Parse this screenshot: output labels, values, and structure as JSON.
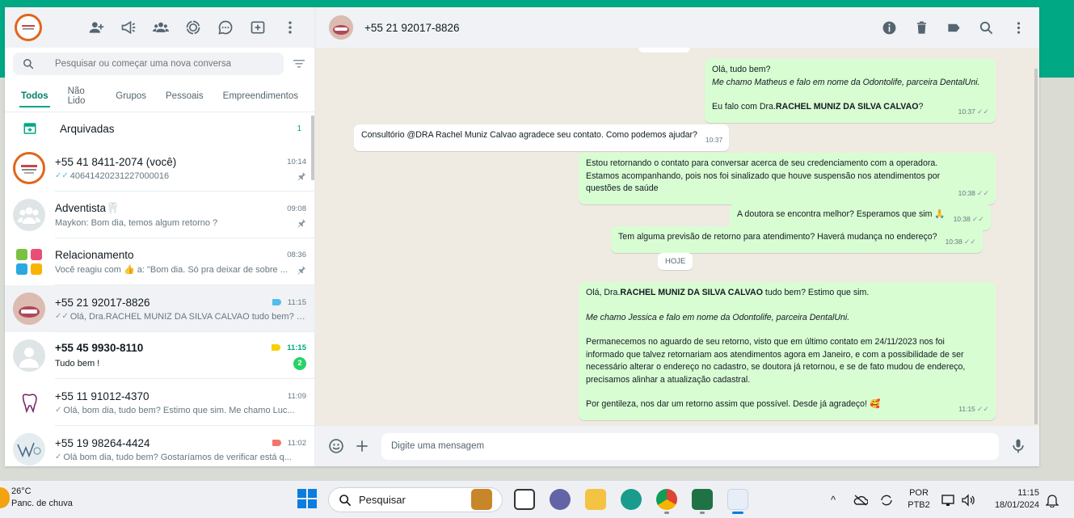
{
  "colors": {
    "brand": "#00a884",
    "outgoing": "#d9fdd3",
    "incoming": "#ffffff",
    "chatbg": "#efeae2"
  },
  "sidebar": {
    "search_placeholder": "Pesquisar ou começar uma nova conversa",
    "header_icons": [
      "new-contact-icon",
      "channels-icon",
      "communities-icon",
      "status-icon",
      "chat-bubble-icon",
      "new-chat-icon",
      "menu-icon"
    ],
    "tabs": [
      {
        "label": "Todos"
      },
      {
        "label": "Não Lido"
      },
      {
        "label": "Grupos"
      },
      {
        "label": "Pessoais"
      },
      {
        "label": "Empreendimentos"
      }
    ],
    "archived": {
      "label": "Arquivadas",
      "count": "1"
    },
    "chats": [
      {
        "name": "+55 41 8411-2074 (você)",
        "time": "10:14",
        "preview": "40641420231227000016"
      },
      {
        "name": "Adventista🦷",
        "time": "09:08",
        "preview": "Maykon: Bom dia, temos algum retorno ?"
      },
      {
        "name": "Relacionamento",
        "time": "08:36",
        "preview": "Você reagiu com 👍 a: \"Bom dia. Só pra deixar de sobre ..."
      },
      {
        "name": "+55 21 92017-8826",
        "time": "11:15",
        "preview": "Olá, Dra.RACHEL MUNIZ DA SILVA CALVAO tudo bem? E..."
      },
      {
        "name": "+55 45 9930-8110",
        "time": "11:15",
        "preview": "Tudo bem !",
        "unread": "2"
      },
      {
        "name": "+55 11 91012-4370",
        "time": "11:09",
        "preview": "Olá, bom dia, tudo bem? Estimo que sim. Me chamo Luc..."
      },
      {
        "name": "+55 19 98264-4424",
        "time": "11:02",
        "preview": "Olá bom dia, tudo bem? Gostaríamos de verificar está q..."
      }
    ]
  },
  "conversation": {
    "title": "+55 21 92017-8826",
    "composer_placeholder": "Digite uma mensagem",
    "date_chip": "HOJE",
    "messages": [
      {
        "l1": "Olá, tudo bem?",
        "l2": "Me chamo Matheus e falo em nome da Odontolife, parceira DentalUni.",
        "l3a": "Eu falo com Dra.",
        "l3b": "RACHEL MUNIZ DA SILVA CALVAO",
        "l3c": "?",
        "time": "10:37"
      },
      {
        "text": "Consultório @DRA Rachel Muniz Calvao agradece seu contato. Como podemos ajudar?",
        "time": "10:37"
      },
      {
        "l1": "Estou retornando o contato para conversar acerca de seu credenciamento com a operadora.",
        "l2": "Estamos acompanhando, pois nos foi sinalizado que houve suspensão nos atendimentos por",
        "l3": "questões de saúde",
        "time": "10:38"
      },
      {
        "text": "A doutora se encontra melhor? Esperamos que sim 🙏",
        "time": "10:38"
      },
      {
        "text": "Tem alguma previsão de retorno para atendimento? Haverá mudança no endereço?",
        "time": "10:38"
      },
      {
        "l1a": "Olá, Dra.",
        "l1b": "RACHEL MUNIZ DA SILVA CALVAO",
        "l1c": " tudo bem? Estimo que sim.",
        "l2": "Me chamo Jessica e falo em nome da Odontolife, parceira DentalUni.",
        "p1": "Permanecemos no aguardo de seu retorno, visto que em último contato em 24/11/2023 nos foi",
        "p2": "informado que talvez retornariam aos atendimentos agora em Janeiro, e com a possibilidade de ser",
        "p3": "necessário alterar o endereço no cadastro, se doutora já retornou, e se de fato mudou de endereço,",
        "p4": "precisamos alinhar a atualização cadastral.",
        "p5": "Por gentileza, nos dar um retorno assim que possível. Desde já agradeço! 🥰",
        "time": "11:15"
      }
    ]
  },
  "taskbar": {
    "temp": "26°C",
    "weather": "Panc. de chuva",
    "search": "Pesquisar",
    "lang1": "POR",
    "lang2": "PTB2",
    "time": "11:15",
    "date": "18/01/2024"
  }
}
